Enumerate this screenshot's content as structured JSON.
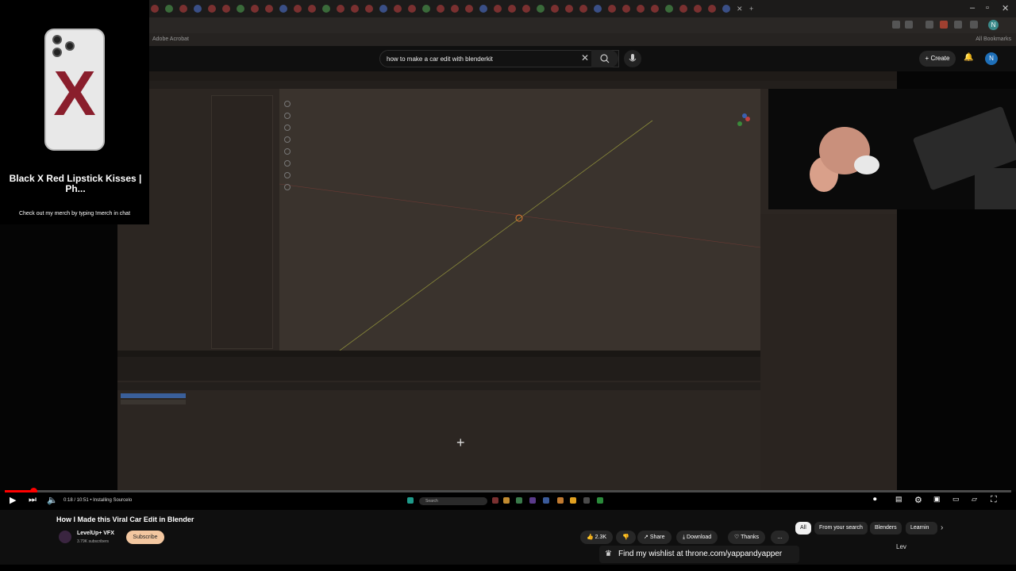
{
  "browser": {
    "bookmark_left": "Adobe Acrobat",
    "bookmarks_all": "All Bookmarks",
    "profile_initial": "N"
  },
  "youtube": {
    "search_value": "how to make a car edit with blenderkit",
    "create_label": "Create",
    "avatar_initial": "N"
  },
  "merch": {
    "title": "Black X Red Lipstick Kisses | Ph...",
    "subtitle": "Check out my merch by typing !merch in chat"
  },
  "player": {
    "time": "0:18 / 10:51 • Installing Sourcelo",
    "progress_fraction": 0.028,
    "taskbar_search": "Search"
  },
  "video": {
    "title": "How I Made this Viral Car Edit in Blender",
    "channel_name": "LevelUp+ VFX",
    "channel_subs": "3.79K subscribers",
    "subscribe_label": "Subscribe",
    "like_count": "2.3K",
    "share_label": "Share",
    "download_label": "Download",
    "thanks_label": "Thanks",
    "more_label": "…"
  },
  "chips": [
    "All",
    "From your search",
    "Blenders",
    "Learnin"
  ],
  "overlay": {
    "wishlist": "Find my wishlist at throne.com/yappandyapper",
    "lev": "Lev"
  },
  "colors": {
    "accent": "#ff0000",
    "subscribe_bg": "#f3c7a0",
    "blender_bg": "#3a332d"
  }
}
